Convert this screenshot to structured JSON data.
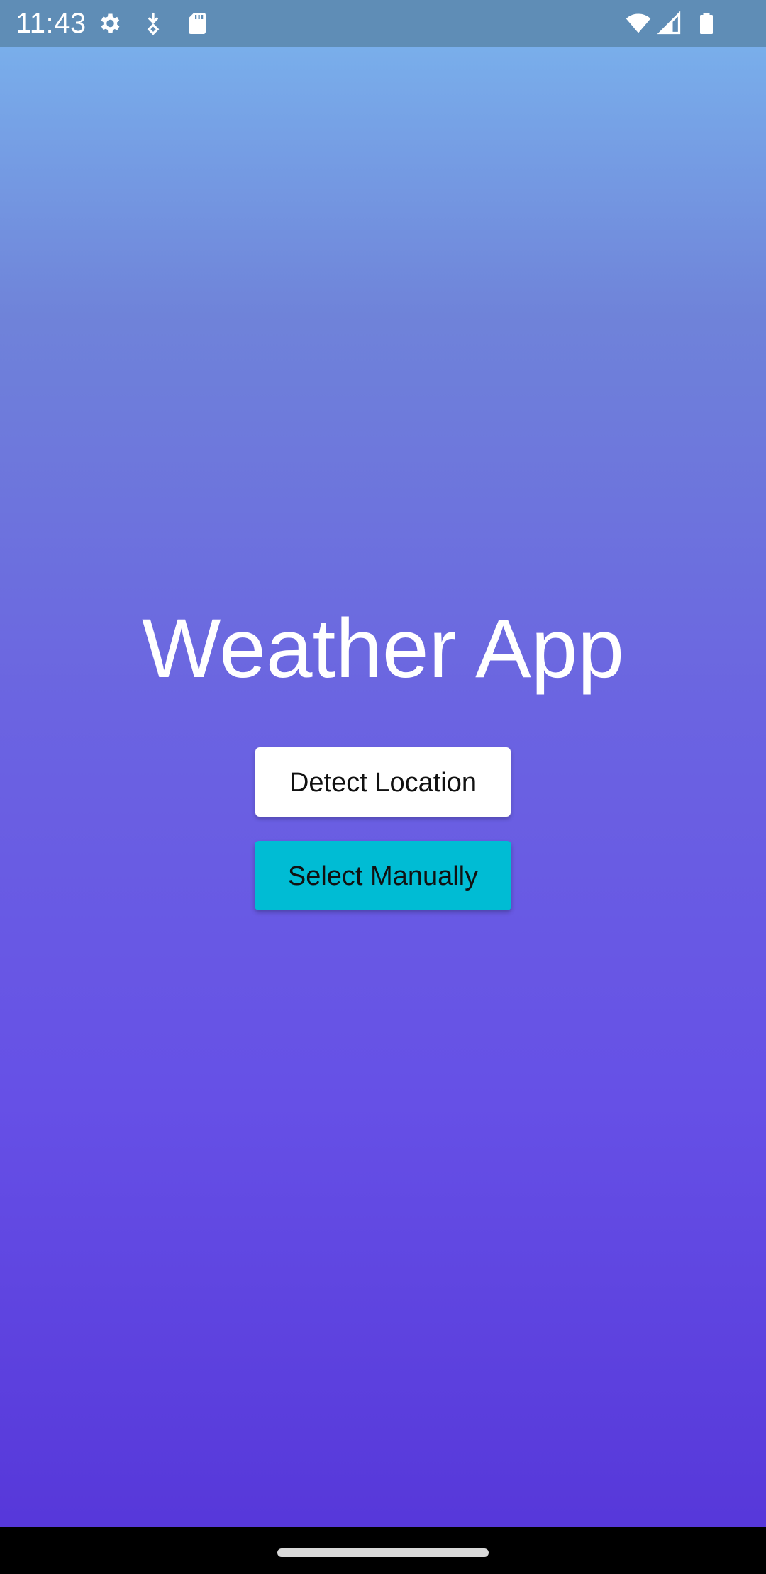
{
  "status_bar": {
    "time": "11:43",
    "icons_left": [
      "settings-icon",
      "download-icon",
      "sd-card-icon"
    ],
    "icons_right": [
      "wifi-icon",
      "signal-icon",
      "battery-icon"
    ]
  },
  "main": {
    "title": "Weather App",
    "detect_button_label": "Detect Location",
    "manual_button_label": "Select Manually"
  },
  "colors": {
    "gradient_top": "#7bb6ee",
    "gradient_bottom": "#5535d8",
    "manual_button": "#00bcd4",
    "detect_button": "#ffffff"
  }
}
